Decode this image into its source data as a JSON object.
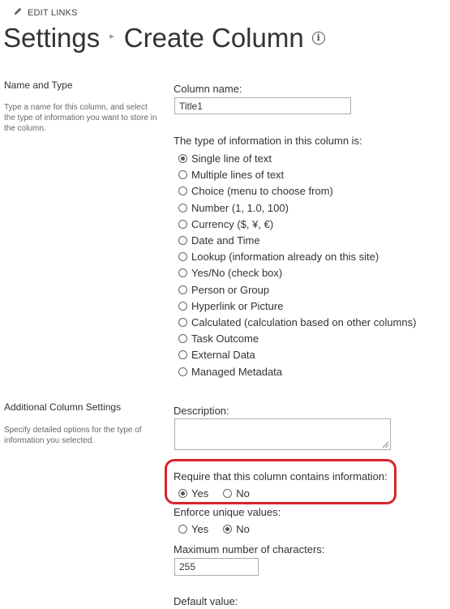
{
  "header": {
    "edit_links_label": "EDIT LINKS",
    "breadcrumb_parent": "Settings",
    "breadcrumb_separator": "▸",
    "page_title": "Create Column",
    "info_icon_glyph": "i"
  },
  "name_and_type": {
    "section_title": "Name and Type",
    "section_description": "Type a name for this column, and select the type of information you want to store in the column.",
    "column_name_label": "Column name:",
    "column_name_value": "Title1",
    "type_label": "The type of information in this column is:",
    "type_options": [
      {
        "label": "Single line of text",
        "selected": true
      },
      {
        "label": "Multiple lines of text",
        "selected": false
      },
      {
        "label": "Choice (menu to choose from)",
        "selected": false
      },
      {
        "label": "Number (1, 1.0, 100)",
        "selected": false
      },
      {
        "label": "Currency ($, ¥, €)",
        "selected": false
      },
      {
        "label": "Date and Time",
        "selected": false
      },
      {
        "label": "Lookup (information already on this site)",
        "selected": false
      },
      {
        "label": "Yes/No (check box)",
        "selected": false
      },
      {
        "label": "Person or Group",
        "selected": false
      },
      {
        "label": "Hyperlink or Picture",
        "selected": false
      },
      {
        "label": "Calculated (calculation based on other columns)",
        "selected": false
      },
      {
        "label": "Task Outcome",
        "selected": false
      },
      {
        "label": "External Data",
        "selected": false
      },
      {
        "label": "Managed Metadata",
        "selected": false
      }
    ]
  },
  "additional_settings": {
    "section_title": "Additional Column Settings",
    "section_description": "Specify detailed options for the type of information you selected.",
    "description_label": "Description:",
    "description_value": "",
    "require_label": "Require that this column contains information:",
    "require_yes_label": "Yes",
    "require_no_label": "No",
    "require_selected": "Yes",
    "unique_label": "Enforce unique values:",
    "unique_yes_label": "Yes",
    "unique_no_label": "No",
    "unique_selected": "No",
    "max_chars_label": "Maximum number of characters:",
    "max_chars_value": "255",
    "default_value_label": "Default value:"
  },
  "colors": {
    "highlight_border": "#d9242b",
    "text": "#333333"
  }
}
